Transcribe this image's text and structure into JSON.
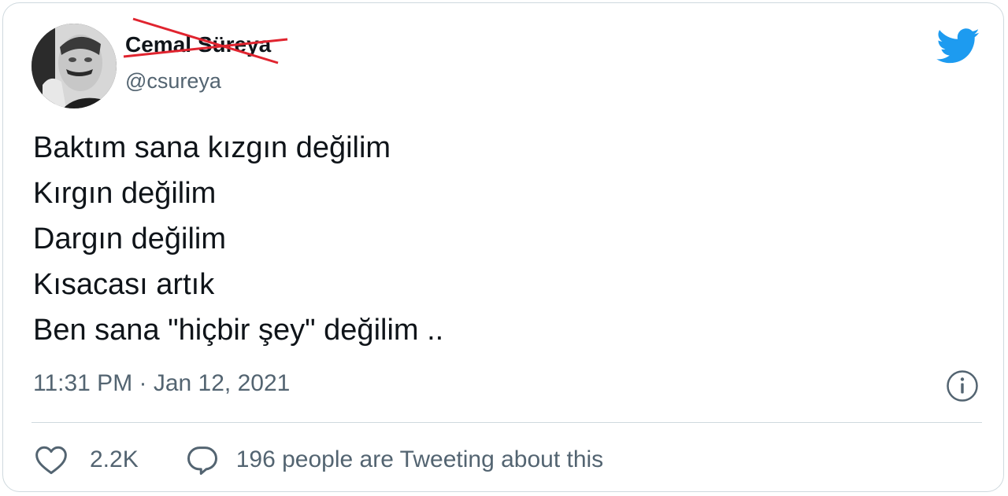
{
  "author": {
    "name": "Cemal Süreya",
    "handle": "@csureya"
  },
  "tweet": {
    "lines": [
      "Baktım sana kızgın değilim",
      "Kırgın değilim",
      "Dargın değilim",
      "Kısacası artık",
      "Ben sana \"hiçbir şey\" değilim .."
    ],
    "timestamp": "11:31 PM · Jan 12, 2021"
  },
  "actions": {
    "likes": "2.2K",
    "tweeting": "196 people are Tweeting about this"
  },
  "colors": {
    "text": "#0f1419",
    "muted": "#536471",
    "brand": "#1d9bf0",
    "strike": "#e0242f",
    "border": "#cfd9de"
  },
  "icons": [
    "twitter-bird-icon",
    "info-icon",
    "heart-icon",
    "reply-bubble-icon"
  ]
}
